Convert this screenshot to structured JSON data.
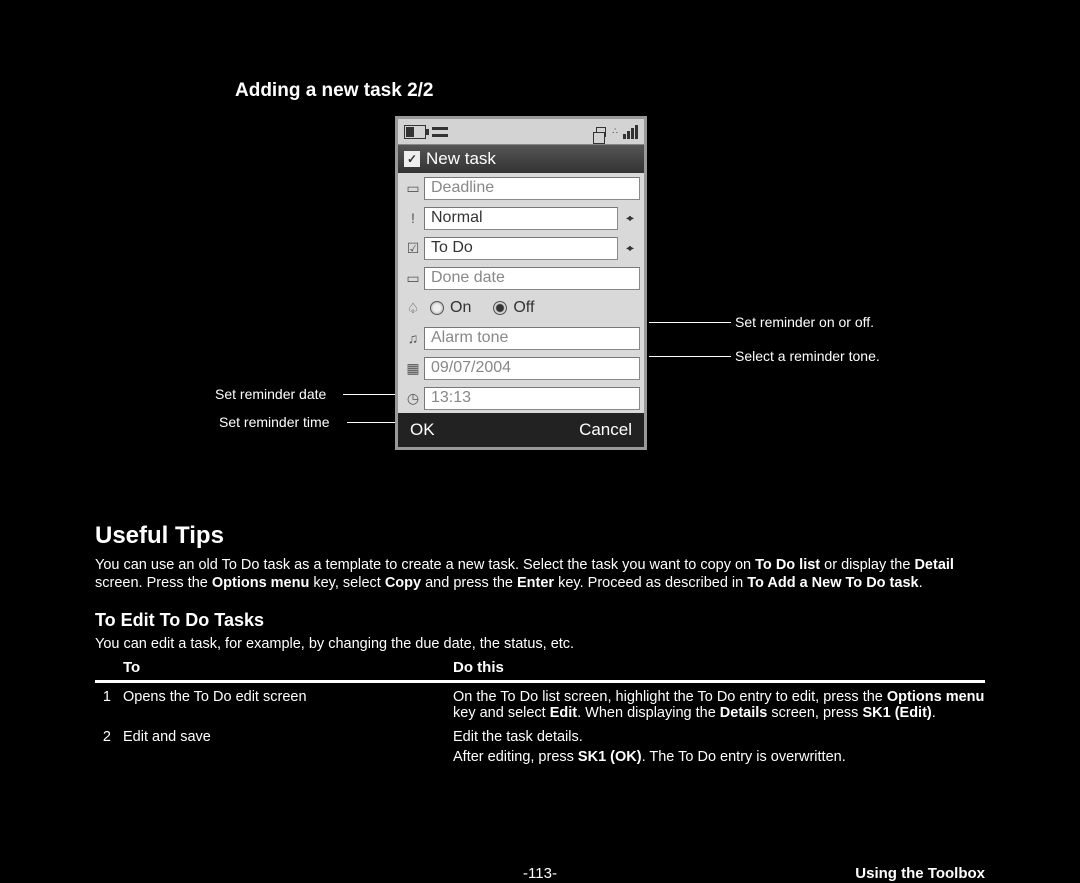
{
  "section_title": "Adding a new task 2/2",
  "phone": {
    "title": "New task",
    "fields": {
      "deadline": "Deadline",
      "priority": "Normal",
      "category": "To Do",
      "done_date": "Done date",
      "on": "On",
      "off": "Off",
      "alarm_tone": "Alarm tone",
      "date": "09/07/2004",
      "time": "13:13"
    },
    "softkeys": {
      "left": "OK",
      "right": "Cancel"
    }
  },
  "callouts": {
    "reminder_date": "Set reminder date",
    "reminder_time": "Set reminder time",
    "reminder_onoff": "Set reminder on or off.",
    "reminder_tone": "Select a reminder tone."
  },
  "tips": {
    "heading": "Useful Tips",
    "p1a": "You can use an old To Do task as a template to create a new task. Select the task you want to copy on ",
    "p1b": "To Do list",
    "p1c": " or display the ",
    "p1d": "Detail",
    "p1e": " screen. Press the ",
    "p1f": "Options menu",
    "p1g": " key, select ",
    "p1h": "Copy",
    "p1i": " and press the ",
    "p1j": "Enter",
    "p1k": " key. Proceed as described in ",
    "p1l": "To Add a New To Do task",
    "p1m": "."
  },
  "edit": {
    "heading": "To Edit To Do Tasks",
    "intro": "You can edit a task, for example, by changing the due date, the status, etc.",
    "col_to": "To",
    "col_do": "Do this",
    "rows": [
      {
        "num": "1",
        "to": "Opens the To Do edit screen",
        "do_a": "On the To Do list screen, highlight the To Do entry to edit, press the ",
        "do_b": "Options menu",
        "do_c": " key and select ",
        "do_d": "Edit",
        "do_e": ". When displaying the ",
        "do_f": "Details",
        "do_g": " screen, press ",
        "do_h": "SK1 (Edit)",
        "do_i": "."
      },
      {
        "num": "2",
        "to": "Edit and save",
        "do_line1": "Edit the task details.",
        "do2_a": "After editing, press ",
        "do2_b": "SK1 (OK)",
        "do2_c": ". The To Do entry is overwritten."
      }
    ]
  },
  "footer": {
    "page": "-113-",
    "section": "Using the Toolbox"
  }
}
